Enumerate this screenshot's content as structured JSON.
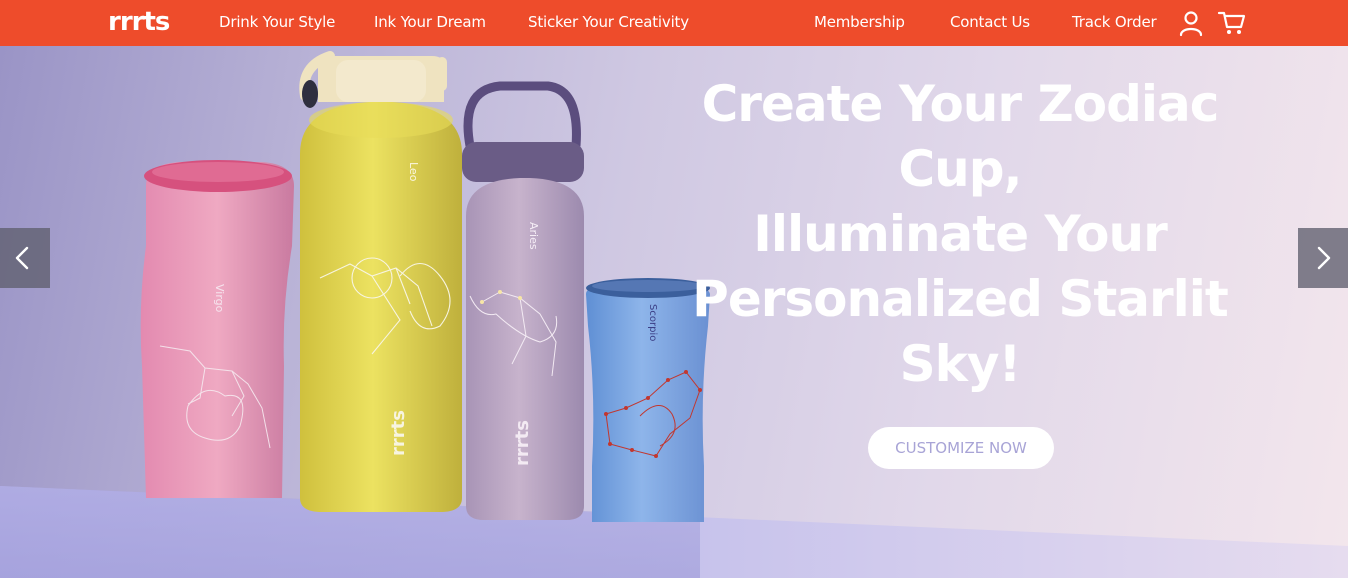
{
  "nav": {
    "logo": "rrrts",
    "links_left": [
      "Drink Your Style",
      "Ink Your Dream",
      "Sticker Your Creativity"
    ],
    "links_right": [
      "Membership",
      "Contact Us",
      "Track Order"
    ],
    "icons": [
      "user-icon",
      "cart-icon"
    ]
  },
  "hero": {
    "headline_lines": [
      "Create Your Zodiac",
      "Cup,",
      "Illuminate Your",
      "Personalized Starlit",
      "Sky!"
    ],
    "cta_label": "CUSTOMIZE NOW",
    "bottles": {
      "virgo": "Virgo",
      "leo": "Leo",
      "aries": "Aries",
      "scorpio": "Scorpio",
      "brand": "rrrts"
    },
    "prev_icon": "chevron-left-icon",
    "next_icon": "chevron-right-icon"
  },
  "colors": {
    "nav_bg": "#ee4c2b",
    "cta_text": "#a8a4d6",
    "arrow_bg": "#5f5f6e"
  }
}
